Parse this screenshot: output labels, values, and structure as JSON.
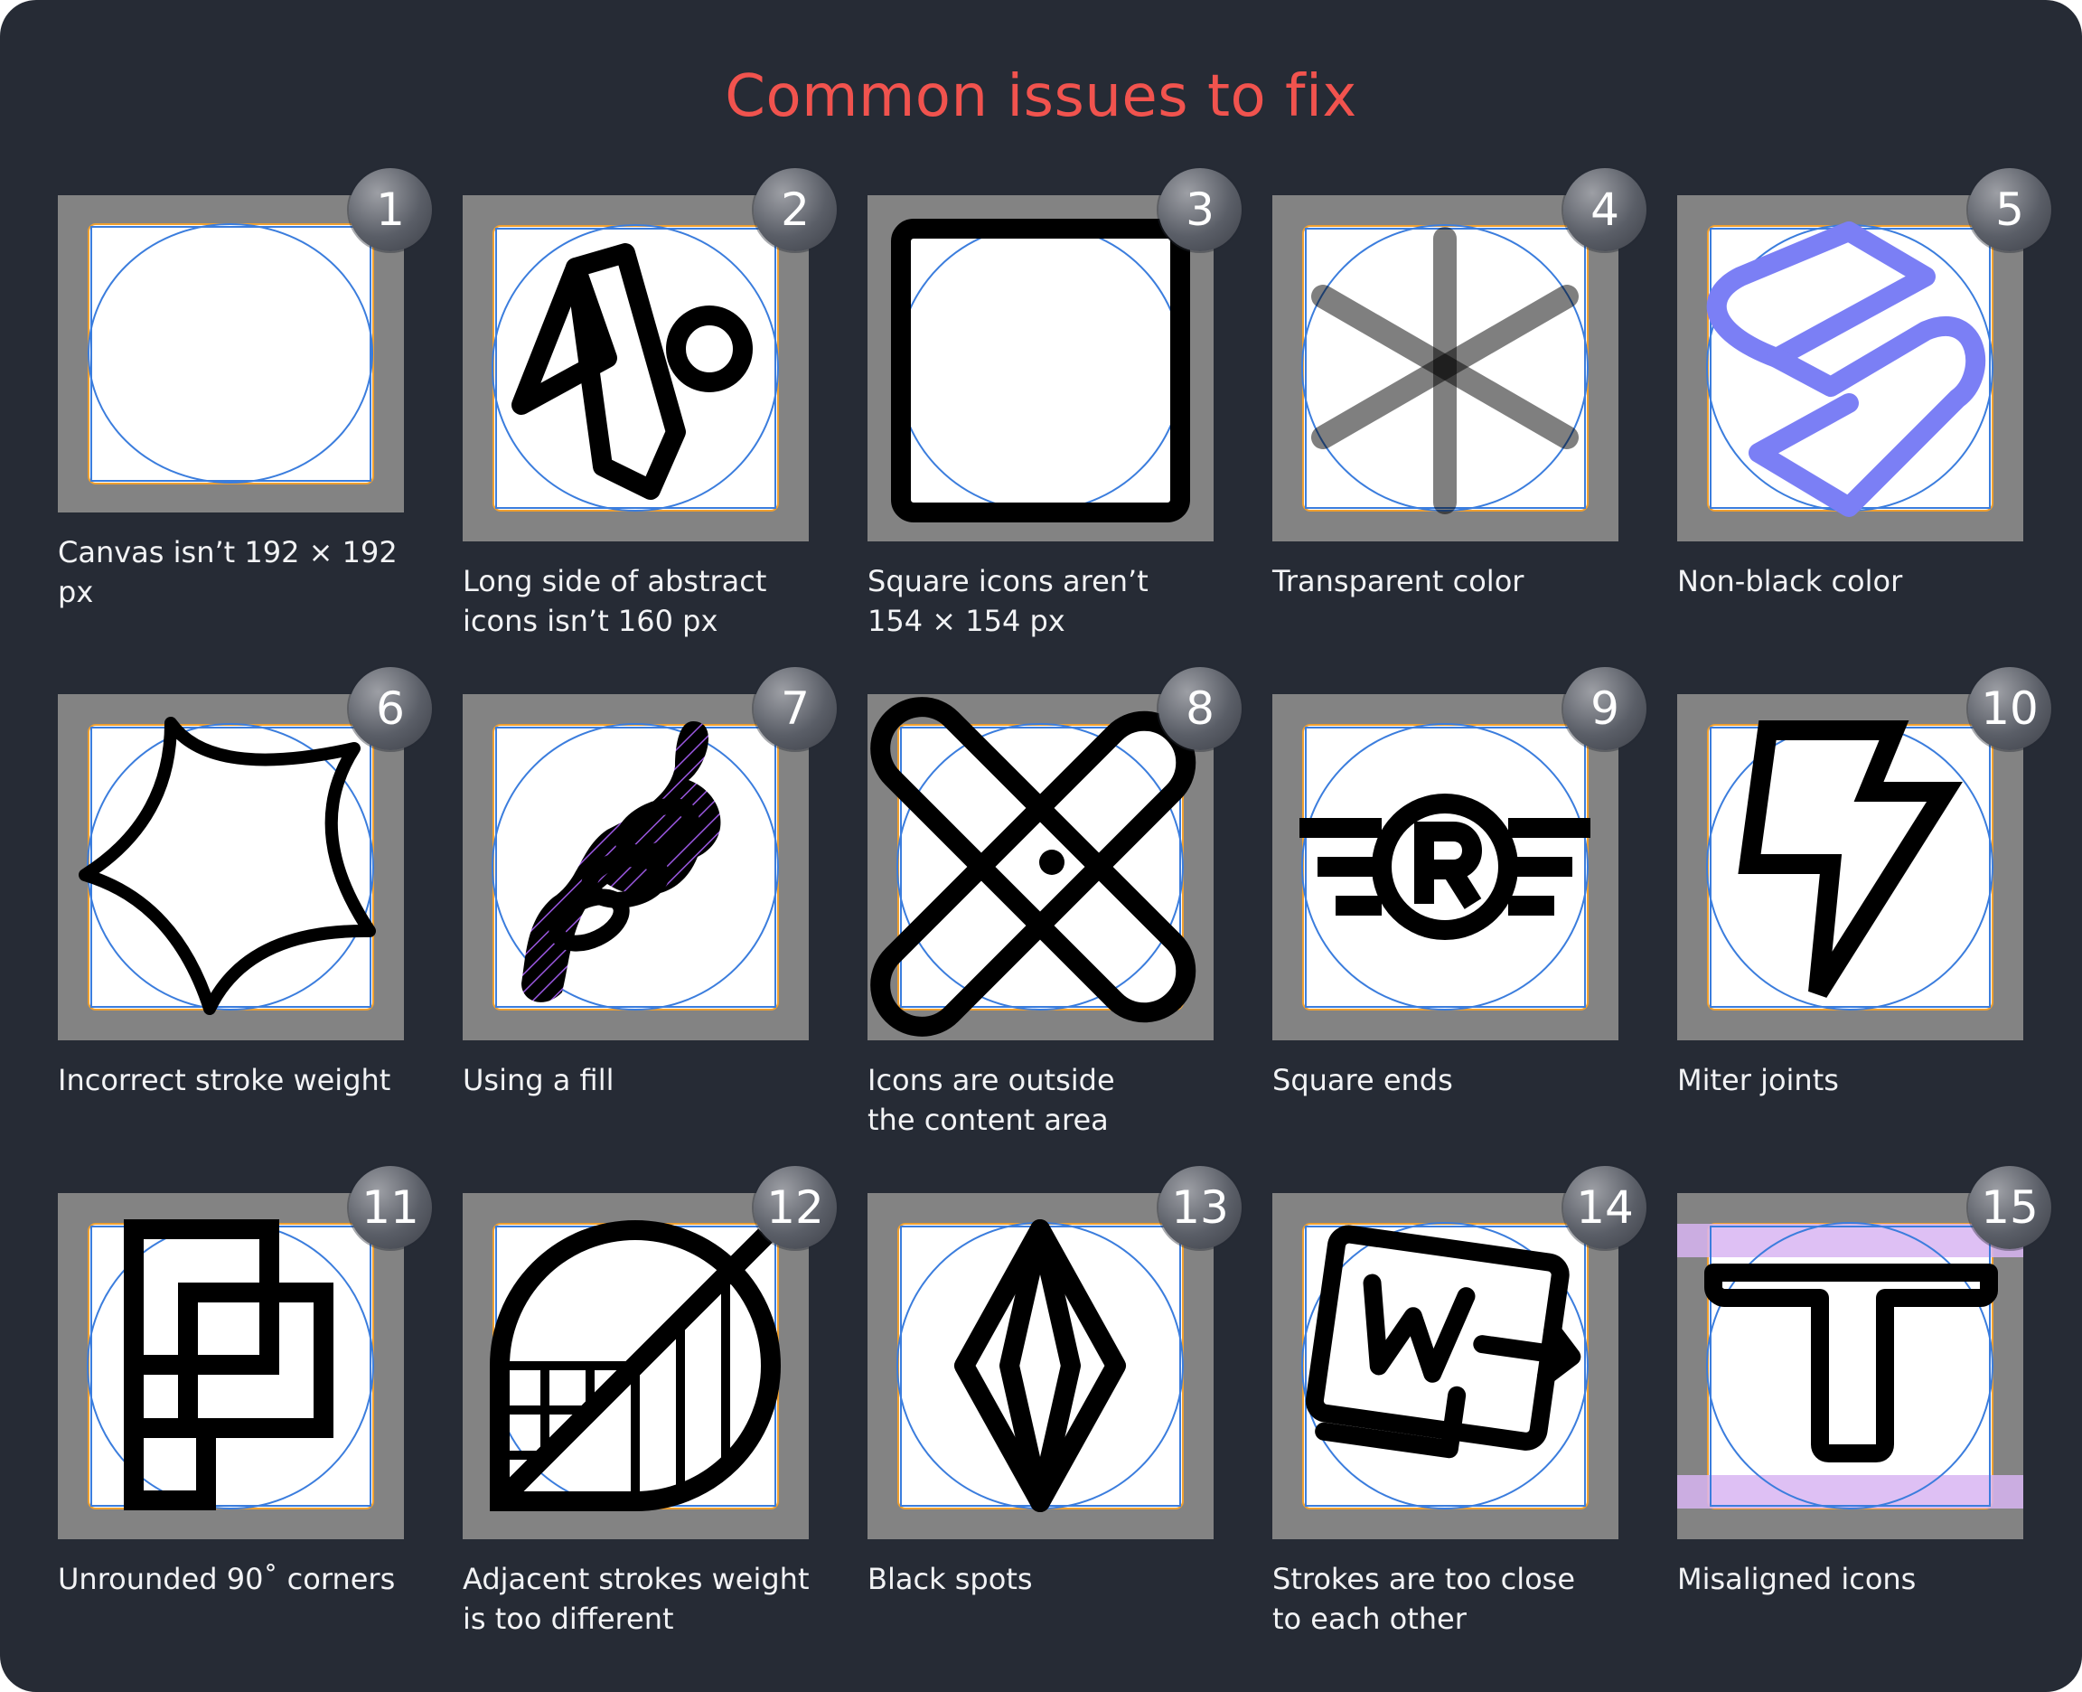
{
  "title": "Common issues to fix",
  "colors": {
    "background": "#262b35",
    "title": "#f1534e",
    "tile": "#838383",
    "guide_circle": "#3b7ddd",
    "guide_square": "#f0a030",
    "nonblack_icon": "#7b7ff5",
    "fill_hatch": "#9a57e0",
    "misalign_band": "#d8b5f2"
  },
  "cards": [
    {
      "number": "1",
      "caption": "Canvas isn’t 192 × 192 px",
      "icon": "blank-circle-icon"
    },
    {
      "number": "2",
      "caption": "Long side of abstract\nicons isn’t 160 px",
      "icon": "abstract-signpost-icon"
    },
    {
      "number": "3",
      "caption": "Square icons aren’t\n154 × 154 px",
      "icon": "square-outline-icon"
    },
    {
      "number": "4",
      "caption": "Transparent color",
      "icon": "asterisk-icon"
    },
    {
      "number": "5",
      "caption": "Non-black color",
      "icon": "s-ribbon-icon"
    },
    {
      "number": "6",
      "caption": "Incorrect stroke weight",
      "icon": "star-burst-icon"
    },
    {
      "number": "7",
      "caption": "Using a fill",
      "icon": "chain-knot-icon"
    },
    {
      "number": "8",
      "caption": "Icons are outside\nthe content area",
      "icon": "bandage-cross-icon"
    },
    {
      "number": "9",
      "caption": "Square ends",
      "icon": "winged-r-icon"
    },
    {
      "number": "10",
      "caption": "Miter joints",
      "icon": "lightning-icon"
    },
    {
      "number": "11",
      "caption": "Unrounded 90˚ corners",
      "icon": "stacked-squares-icon"
    },
    {
      "number": "12",
      "caption": "Adjacent strokes weight\nis too different",
      "icon": "leaf-grid-icon"
    },
    {
      "number": "13",
      "caption": "Black spots",
      "icon": "diamond-icon"
    },
    {
      "number": "14",
      "caption": "Strokes are too close\nto each other",
      "icon": "word-export-icon"
    },
    {
      "number": "15",
      "caption": "Misaligned icons",
      "icon": "letter-t-icon"
    }
  ]
}
